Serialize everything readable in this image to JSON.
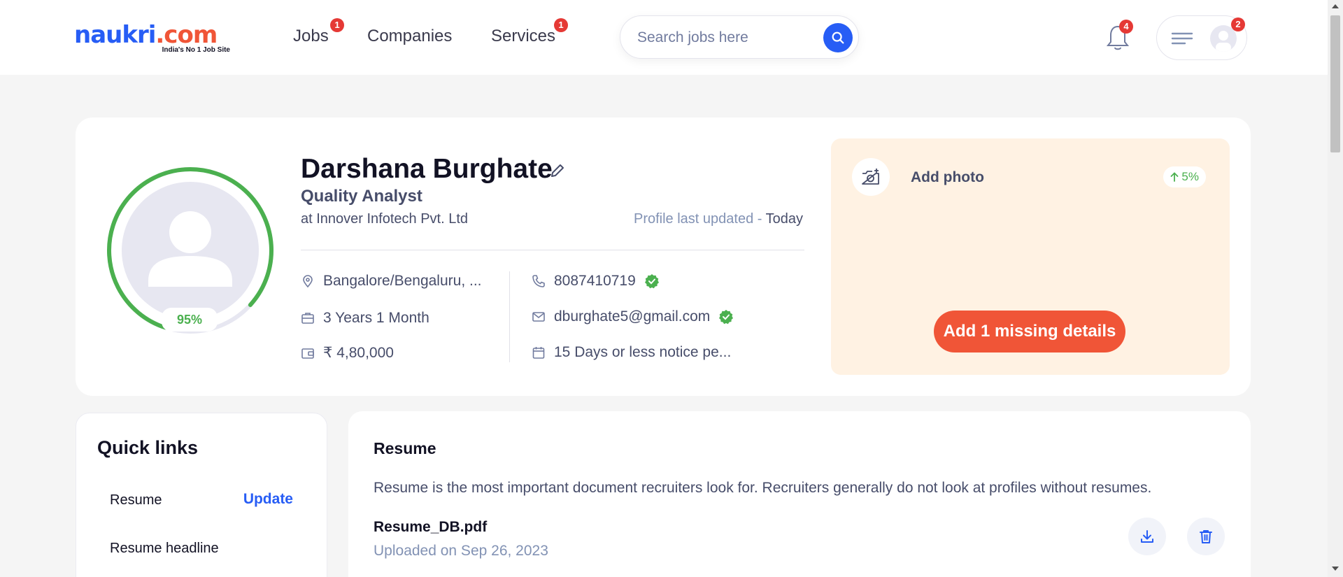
{
  "header": {
    "logo_text": "naukri",
    "logo_suffix": ".com",
    "logo_tagline": "India's No 1 Job Site",
    "nav": [
      {
        "label": "Jobs",
        "badge": "1"
      },
      {
        "label": "Companies",
        "badge": ""
      },
      {
        "label": "Services",
        "badge": "1"
      }
    ],
    "search_placeholder": "Search jobs here",
    "notifications_badge": "4",
    "menu_badge": "2"
  },
  "profile": {
    "completion": "95%",
    "completion_value": 0.95,
    "name": "Darshana Burghate",
    "designation": "Quality Analyst",
    "company": "at Innover Infotech Pvt. Ltd",
    "updated_label": "Profile last updated - ",
    "updated_value": "Today",
    "location": "Bangalore/Bengaluru, ...",
    "experience": "3 Years 1 Month",
    "salary": "₹ 4,80,000",
    "phone": "8087410719",
    "email": "dburghate5@gmail.com",
    "notice": "15 Days or less notice pe..."
  },
  "missing": {
    "add_photo": "Add photo",
    "boost": "5%",
    "button": "Add 1 missing details"
  },
  "quick_links": {
    "title": "Quick links",
    "items": [
      {
        "label": "Resume",
        "action": "Update"
      },
      {
        "label": "Resume headline"
      }
    ]
  },
  "resume": {
    "title": "Resume",
    "description": "Resume is the most important document recruiters look for. Recruiters generally do not look at profiles without resumes.",
    "file_name": "Resume_DB.pdf",
    "uploaded": "Uploaded on Sep 26, 2023"
  },
  "colors": {
    "brand_blue": "#275df5",
    "accent_orange": "#f05537",
    "success_green": "#4bb04f",
    "badge_red": "#e53935"
  }
}
